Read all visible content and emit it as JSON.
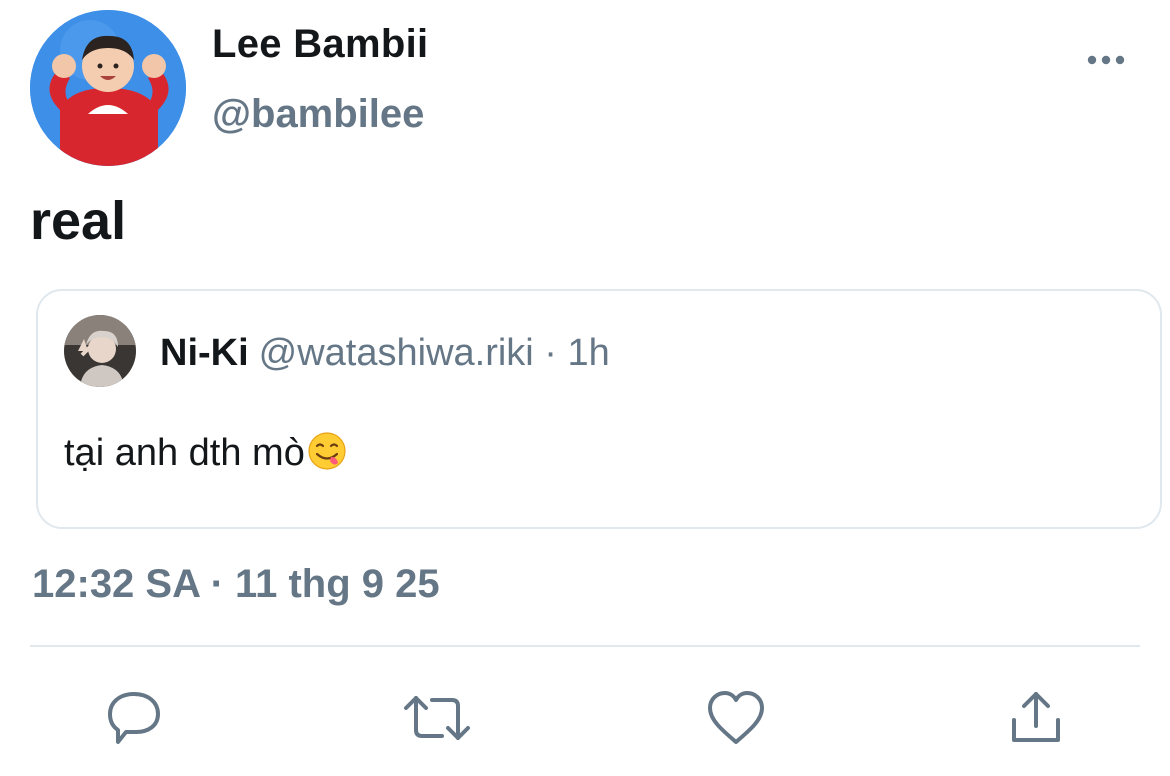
{
  "author": {
    "display_name": "Lee Bambii",
    "handle": "@bambilee",
    "avatar": "avatar-photo"
  },
  "tweet": {
    "text": "real",
    "timestamp": "12:32 SA · 11 thg 9 25"
  },
  "quoted_tweet": {
    "display_name": "Ni-Ki",
    "handle": "@watashiwa.riki",
    "separator": " · ",
    "time": "1h",
    "text": "tại anh dth mò",
    "emoji": "yum-face-emoji"
  },
  "actions": [
    {
      "icon": "reply-icon"
    },
    {
      "icon": "retweet-icon"
    },
    {
      "icon": "like-icon"
    },
    {
      "icon": "share-icon"
    }
  ],
  "colors": {
    "text_primary": "#14171a",
    "text_secondary": "#657786",
    "border": "#e1e8ed"
  }
}
